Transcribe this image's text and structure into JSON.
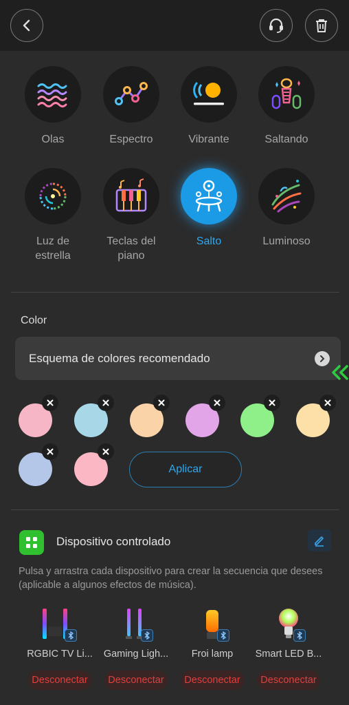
{
  "header": {
    "back_icon": "chevron-left-icon",
    "support_icon": "headset-icon",
    "delete_icon": "trash-icon"
  },
  "effects": [
    {
      "label": "Olas",
      "icon": "waves-icon",
      "selected": false
    },
    {
      "label": "Espectro",
      "icon": "spectrum-line-icon",
      "selected": false
    },
    {
      "label": "Vibrante",
      "icon": "vibrant-sun-icon",
      "selected": false
    },
    {
      "label": "Saltando",
      "icon": "jumping-bars-icon",
      "selected": false
    },
    {
      "label": "Luz de estrella",
      "icon": "starlight-swirl-icon",
      "selected": false
    },
    {
      "label": "Teclas del piano",
      "icon": "piano-keys-icon",
      "selected": false
    },
    {
      "label": "Salto",
      "icon": "trampoline-icon",
      "selected": true
    },
    {
      "label": "Luminoso",
      "icon": "luminous-streaks-icon",
      "selected": false
    }
  ],
  "color": {
    "title": "Color",
    "scheme_label": "Esquema de colores recomendado",
    "swatches": [
      "#f7b6c6",
      "#a8d8e8",
      "#fbd3a8",
      "#e2a6e8",
      "#8ff08a",
      "#fde0a8",
      "#b4c7e8",
      "#fbb8c4"
    ],
    "apply_label": "Aplicar",
    "accent": "#2ea8ee"
  },
  "devices": {
    "title": "Dispositivo controlado",
    "description": "Pulsa y arrastra cada dispositivo para crear la secuencia que desees (aplicable a algunos efectos de música).",
    "items": [
      {
        "name": "RGBIC TV Li...",
        "icon": "tv-light-bars-icon",
        "action": "Desconectar"
      },
      {
        "name": "Gaming Ligh...",
        "icon": "gaming-light-bars-icon",
        "action": "Desconectar"
      },
      {
        "name": "Froi lamp",
        "icon": "lamp-icon",
        "action": "Desconectar"
      },
      {
        "name": "Smart LED B...",
        "icon": "led-bulb-icon",
        "action": "Desconectar"
      }
    ]
  }
}
